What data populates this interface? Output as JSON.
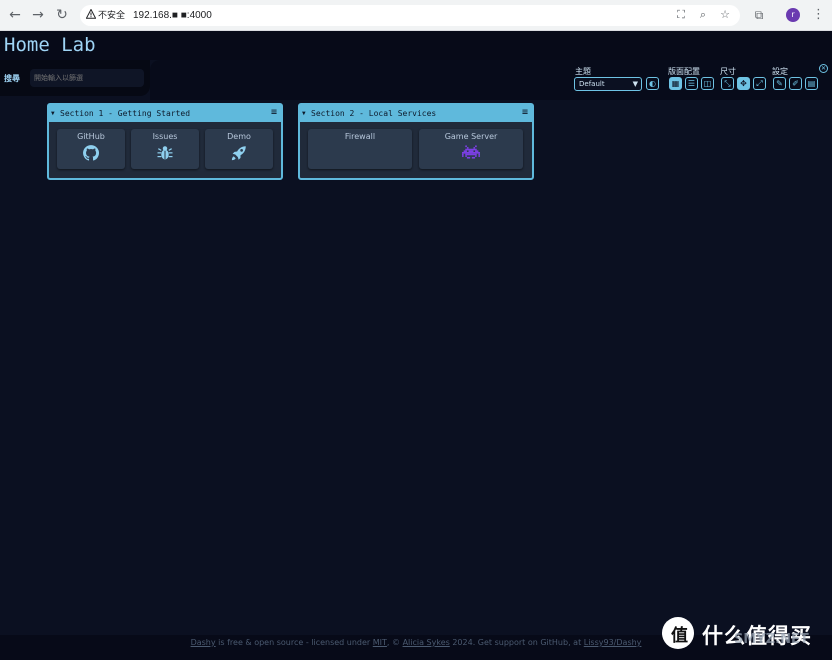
{
  "browser": {
    "insecure_label": "不安全",
    "url": "192.168.■   ■:4000"
  },
  "app": {
    "title": "Home Lab",
    "search_label": "搜尋",
    "search_placeholder": "開始輸入以篩選"
  },
  "settings": {
    "theme_label": "主題",
    "theme_value": "Default",
    "layout_label": "版面配置",
    "size_label": "尺寸",
    "config_label": "設定"
  },
  "sections": [
    {
      "title": "Section 1 - Getting Started",
      "items": [
        {
          "label": "GitHub",
          "icon": "github-icon"
        },
        {
          "label": "Issues",
          "icon": "bug-icon"
        },
        {
          "label": "Demo",
          "icon": "rocket-icon"
        }
      ]
    },
    {
      "title": "Section 2 - Local Services",
      "items": [
        {
          "label": "Firewall",
          "icon": ""
        },
        {
          "label": "Game Server",
          "icon": "space-invader-icon"
        }
      ]
    }
  ],
  "footer": {
    "link_dashy": "Dashy",
    "text1": " is free & open source - licensed under ",
    "link_mit": "MIT",
    "text2": ", © ",
    "link_author": "Alicia Sykes",
    "text3": " 2024. Get support on GitHub, at ",
    "link_repo": "Lissy93/Dashy"
  },
  "watermark": {
    "circle": "值",
    "text": "什么值得买",
    "sub": "SMYZ.NET"
  },
  "colors": {
    "accent": "#5fb9dc",
    "background": "#0b1021",
    "item": "#2c3a4d"
  }
}
